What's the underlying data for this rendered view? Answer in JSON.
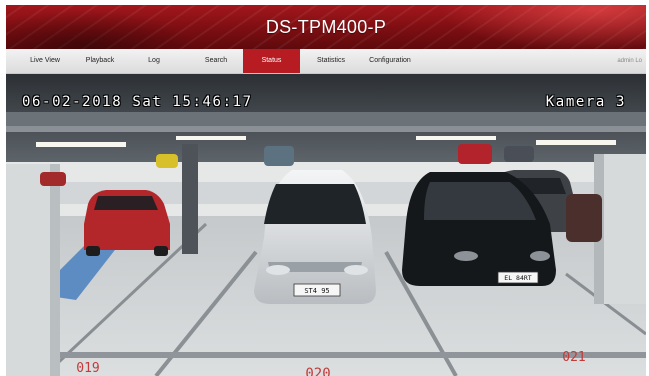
{
  "header": {
    "title": "DS-TPM400-P"
  },
  "nav": {
    "tabs": [
      {
        "label": "Live View",
        "active": false
      },
      {
        "label": "Playback",
        "active": false
      },
      {
        "label": "Log",
        "active": false
      },
      {
        "label": "Search",
        "active": false
      },
      {
        "label": "Status",
        "active": true
      },
      {
        "label": "Statistics",
        "active": false
      },
      {
        "label": "Configuration",
        "active": false
      }
    ],
    "user": "admin  Lo"
  },
  "video": {
    "timestamp": "06-02-2018 Sat 15:46:17",
    "camera_label": "Kamera 3",
    "space_numbers": [
      "019",
      "020",
      "021"
    ],
    "plates": [
      "ST4 95",
      "EL 84RT"
    ]
  },
  "colors": {
    "brand_red": "#b71c22",
    "header_dark": "#7c0e12"
  }
}
